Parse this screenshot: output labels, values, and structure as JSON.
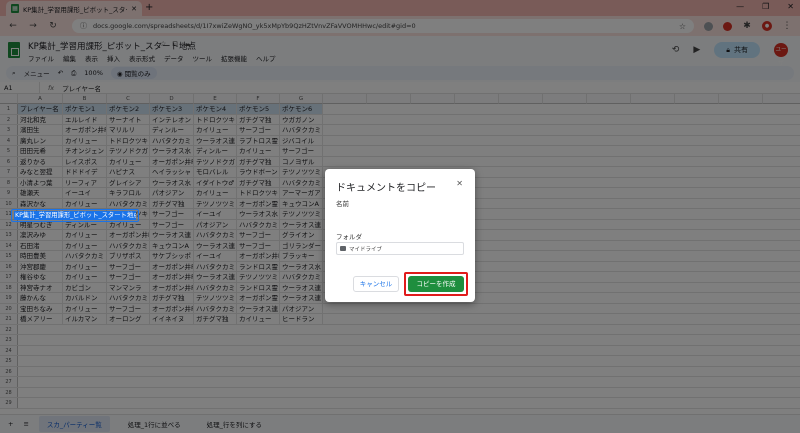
{
  "browser": {
    "tab_title": "KP集計_学習用課形_ピボット_スタート地点",
    "url": "docs.google.com/spreadsheets/d/1I7xwiZeWgNO_yk5xMpYb9QzHZtVnvZFaVVOMHHwc/edit#gid=0"
  },
  "sheets": {
    "doc_title": "KP集計_学習用課形_ピボット_スタート地点",
    "menu": [
      "ファイル",
      "編集",
      "表示",
      "挿入",
      "表示形式",
      "データ",
      "ツール",
      "拡張機能",
      "ヘルプ"
    ],
    "share_label": "共有",
    "avatar_initials": "ユーザ",
    "toolbar": {
      "search_label": "メニュー",
      "zoom": "100%",
      "mode_label": "閲覧のみ"
    },
    "name_box": "A1",
    "formula": "プレイヤー名"
  },
  "grid": {
    "col_letters": [
      "A",
      "B",
      "C",
      "D",
      "E",
      "F",
      "G"
    ],
    "headers": [
      "プレイヤー名",
      "ポケモン1",
      "ポケモン2",
      "ポケモン3",
      "ポケモン4",
      "ポケモン5",
      "ポケモン6"
    ],
    "rows": [
      [
        "河北和克",
        "エルレイド",
        "サーナイト",
        "インテレオン",
        "トドロクツキ",
        "ガチグマ独",
        "ウガガノン"
      ],
      [
        "濱田生",
        "オーガポン井F",
        "マリルリ",
        "ディンルー",
        "カイリュー",
        "サーフゴー",
        "ハバタクカミ"
      ],
      [
        "廣丸レン",
        "カイリュー",
        "トドロクツキ",
        "ハバタクカミ",
        "ウーラオス連",
        "ラブトロス霊",
        "ジバコイル"
      ],
      [
        "田田元希",
        "チオンジェン",
        "テツノドクガ",
        "ウーラオス水",
        "ディンルー",
        "カイリュー",
        "サーフゴー"
      ],
      [
        "返りかる",
        "レイスポス",
        "カイリュー",
        "オーガポン井F",
        "テツノドクガ",
        "ガチグマ独",
        "コノヨザル"
      ],
      [
        "みなと翌提",
        "ドドドイデ",
        "ハピナス",
        "ヘイラッシャ",
        "モロバレル",
        "ラウドボーン",
        "テツノツツミ"
      ],
      [
        "小清よつ葉",
        "リーフィア",
        "グレイシア",
        "ウーラオス水",
        "イダイトウ♂",
        "ガチグマ独",
        "ハバタクカミ"
      ],
      [
        "雄瀬天",
        "イーユイ",
        "キラフロル",
        "パオジアン",
        "カイリュー",
        "トドロクツキ",
        "アーマーガア"
      ],
      [
        "森沢かな",
        "カイリュー",
        "ハバタクカミ",
        "ガチグマ独",
        "テツノツツミ",
        "オーガポン霊",
        "キュウコンA"
      ],
      [
        "木下素々子",
        "ランドロス霊",
        "トドロクツキ",
        "サーフゴー",
        "イーユイ",
        "ウーラオス水",
        "テツノツツミ"
      ],
      [
        "明星つむぎ",
        "ディンルー",
        "カイリュー",
        "サーフゴー",
        "パオジアン",
        "ハバタクカミ",
        "ウーラオス連"
      ],
      [
        "凜沢みゆ",
        "カイリュー",
        "オーガポン井F",
        "ウーラオス連",
        "ハバタクカミ",
        "サーフゴー",
        "グライオン"
      ],
      [
        "石田渚",
        "カイリュー",
        "ハバタクカミ",
        "キュウコンA",
        "ウーラオス連",
        "サーフゴー",
        "ゴリランダー"
      ],
      [
        "時田豊美",
        "ハバタクカミ",
        "ブリザポス",
        "サケブシッポ",
        "イーユイ",
        "オーガポン井F",
        "ブラッキー"
      ],
      [
        "沖宮郡慶",
        "カイリュー",
        "サーフゴー",
        "オーガポン井F",
        "ハバタクカミ",
        "ランドロス霊",
        "ウーラオス水"
      ],
      [
        "権谷ゆな",
        "カイリュー",
        "サーフゴー",
        "オーガポン井F",
        "ウーラオス連",
        "テツノツツミ",
        "ハバタクカミ"
      ],
      [
        "神宮寺ナオ",
        "カビゴン",
        "マンマンラ",
        "オーガポン井F",
        "ハバタクカミ",
        "ランドロス霊",
        "ウーラオス連"
      ],
      [
        "藤かんな",
        "カバルドン",
        "ハバタクカミ",
        "ガチグマ独",
        "テツノツツミ",
        "オーガポン霊",
        "ウーラオス連"
      ],
      [
        "宝田ちなみ",
        "カイリュー",
        "サーフゴー",
        "オーガポン井F",
        "ハバタクカミ",
        "ウーラオス連",
        "パオジアン"
      ],
      [
        "橋メアリー",
        "イルカマン",
        "オーロング",
        "イイネイヌ",
        "ガチグマ独",
        "カイリュー",
        "ヒードラン"
      ]
    ]
  },
  "sheet_tabs": [
    "スカ_パーティー覧",
    "処理_1行に並べる",
    "処理_行を列にする"
  ],
  "dialog": {
    "title": "ドキュメントをコピー",
    "name_label": "名前",
    "name_value": "KP集計_学習用課形_ピボット_スタート地点 の",
    "folder_label": "フォルダ",
    "folder_value": "マイドライブ",
    "cancel_label": "キャンセル",
    "create_label": "コピーを作成"
  },
  "colors": {
    "overlay": "#00000080",
    "create_button": "#1e8e3e",
    "highlight_ring": "#e01b1b",
    "header_fill": "#cfe2f3"
  }
}
